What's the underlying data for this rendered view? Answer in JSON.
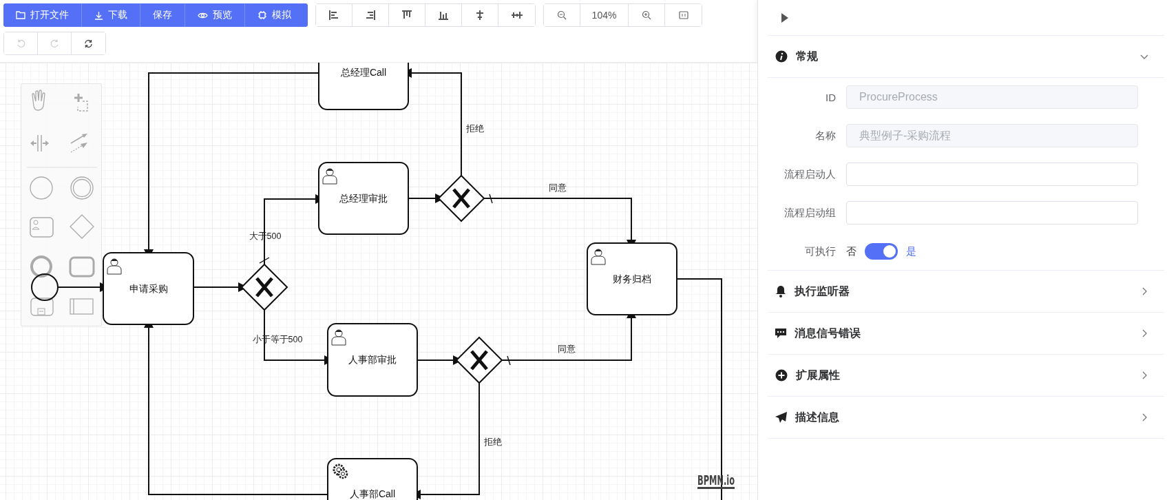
{
  "toolbar": {
    "file_buttons": [
      {
        "label": "打开文件"
      },
      {
        "label": "下载"
      },
      {
        "label": "保存"
      },
      {
        "label": "预览"
      },
      {
        "label": "模拟"
      }
    ],
    "zoom_level": "104%",
    "history_buttons": [
      {
        "disabled": true
      },
      {
        "disabled": true
      },
      {
        "disabled": false
      }
    ]
  },
  "diagram": {
    "tasks": [
      {
        "kind": "call",
        "label": "总经理Call"
      },
      {
        "kind": "user",
        "label": "总经理审批"
      },
      {
        "kind": "user",
        "label": "申请采购"
      },
      {
        "kind": "user",
        "label": "财务归档"
      },
      {
        "kind": "user",
        "label": "人事部审批"
      },
      {
        "kind": "service",
        "label": "人事部Call"
      }
    ],
    "flow_labels": [
      "拒绝",
      "同意",
      "大于500",
      "小于等于500",
      "同意",
      "拒绝"
    ],
    "watermark": "BPMN.io"
  },
  "panel": {
    "sections": [
      {
        "title": "常规",
        "expanded": true,
        "fields": [
          {
            "label": "ID",
            "value": "ProcureProcess",
            "disabled": true
          },
          {
            "label": "名称",
            "value": "典型例子-采购流程",
            "disabled": true
          },
          {
            "label": "流程启动人",
            "disabled": false
          },
          {
            "label": "流程启动组",
            "disabled": false
          }
        ],
        "switch": {
          "label": "可执行",
          "off_text": "否",
          "on_text": "是",
          "on": true
        }
      },
      {
        "title": "执行监听器",
        "expanded": false
      },
      {
        "title": "消息信号错误",
        "expanded": false
      },
      {
        "title": "扩展属性",
        "expanded": false
      },
      {
        "title": "描述信息",
        "expanded": false
      }
    ]
  }
}
